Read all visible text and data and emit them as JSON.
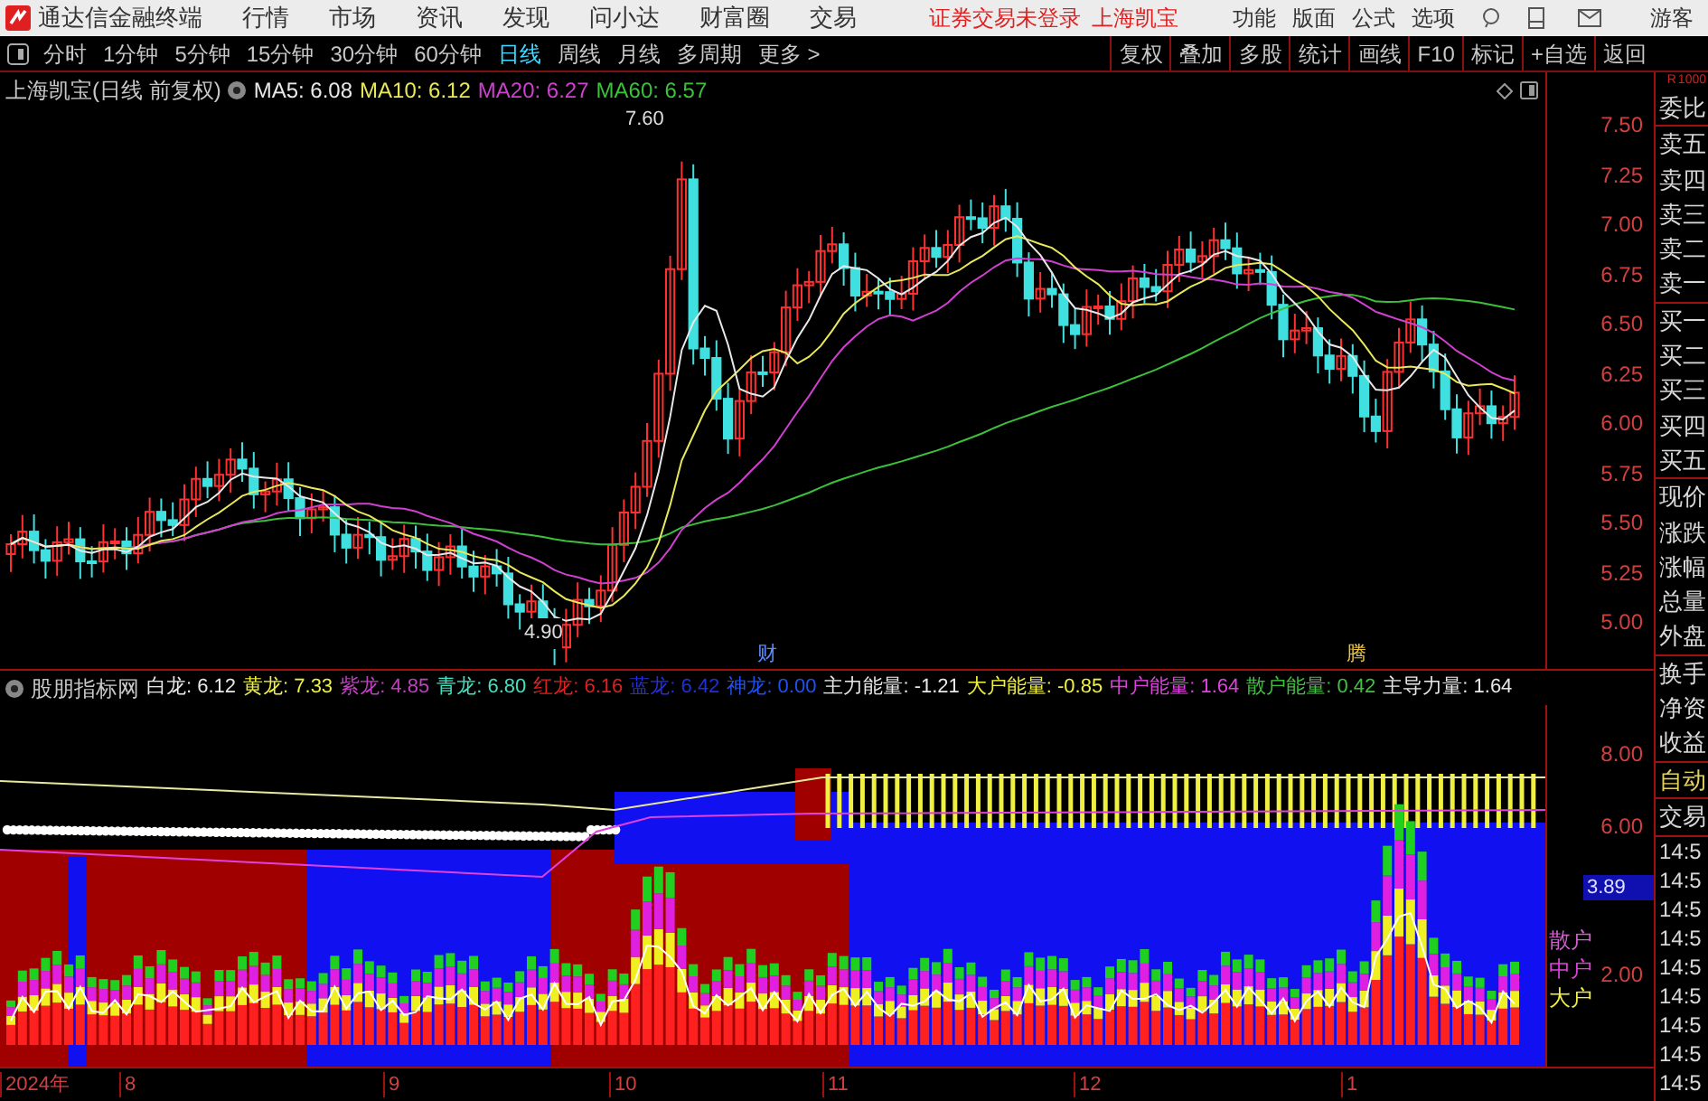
{
  "app": {
    "name": "通达信金融终端"
  },
  "menu": [
    "行情",
    "市场",
    "资讯",
    "发现",
    "问小达",
    "财富圈",
    "交易"
  ],
  "notice": {
    "login": "证券交易未登录",
    "stock": "上海凯宝"
  },
  "title_menu": [
    "功能",
    "版面",
    "公式",
    "选项"
  ],
  "user": "游客",
  "periods": [
    {
      "label": "分时",
      "selected": false
    },
    {
      "label": "1分钟",
      "selected": false
    },
    {
      "label": "5分钟",
      "selected": false
    },
    {
      "label": "15分钟",
      "selected": false
    },
    {
      "label": "30分钟",
      "selected": false
    },
    {
      "label": "60分钟",
      "selected": false
    },
    {
      "label": "日线",
      "selected": true
    },
    {
      "label": "周线",
      "selected": false
    },
    {
      "label": "月线",
      "selected": false
    },
    {
      "label": "多周期",
      "selected": false
    },
    {
      "label": "更多 >",
      "selected": false
    }
  ],
  "tools": [
    "复权",
    "叠加",
    "多股",
    "统计",
    "画线",
    "F10",
    "标记",
    "+自选",
    "返回"
  ],
  "main_chart": {
    "title": "上海凯宝(日线 前复权)",
    "ma": [
      {
        "label": "MA5: 6.08",
        "color": "#e8e8e8"
      },
      {
        "label": "MA10: 6.12",
        "color": "#e8e85a"
      },
      {
        "label": "MA20: 6.27",
        "color": "#d040d0"
      },
      {
        "label": "MA60: 6.57",
        "color": "#3cc03c"
      }
    ],
    "price_axis": [
      "7.50",
      "7.25",
      "7.00",
      "6.75",
      "6.50",
      "6.25",
      "6.00",
      "5.75",
      "5.50",
      "5.25",
      "5.00"
    ],
    "high_label": "7.60",
    "low_label": "4.90",
    "markers": [
      {
        "label": "财",
        "color": "#5a8cff"
      },
      {
        "label": "腾",
        "color": "#e8c040"
      }
    ]
  },
  "indicator": {
    "name": "股朋指标网",
    "values": [
      {
        "label": "白龙: 6.12",
        "color": "#e8e8e8"
      },
      {
        "label": "黄龙: 7.33",
        "color": "#f0f040"
      },
      {
        "label": "紫龙: 4.85",
        "color": "#c040c0"
      },
      {
        "label": "青龙: 6.80",
        "color": "#40e0c0"
      },
      {
        "label": "红龙: 6.16",
        "color": "#e02020"
      },
      {
        "label": "蓝龙: 6.42",
        "color": "#2030e0"
      },
      {
        "label": "神龙: 0.00",
        "color": "#2050f0"
      },
      {
        "label": "主力能量: -1.21",
        "color": "#e8e8e8"
      },
      {
        "label": "大户能量: -0.85",
        "color": "#f0f040"
      },
      {
        "label": "中户能量: 1.64",
        "color": "#e040e0"
      },
      {
        "label": "散户能量: 0.42",
        "color": "#40c040"
      },
      {
        "label": "主导力量: 1.64",
        "color": "#e8e8e8"
      }
    ],
    "axis": [
      "8.00",
      "6.00",
      "2.00"
    ],
    "current": "3.89",
    "legend": [
      {
        "label": "散户",
        "color": "#d060d0"
      },
      {
        "label": "中户",
        "color": "#e040e0"
      },
      {
        "label": "大户",
        "color": "#f0f040"
      }
    ]
  },
  "date_axis": [
    "2024年",
    "8",
    "9",
    "10",
    "11",
    "12",
    "1"
  ],
  "quote_panel": {
    "badge": "R",
    "badge_value": "1000",
    "groups": [
      [
        "委比"
      ],
      [
        "卖五",
        "卖四",
        "卖三",
        "卖二",
        "卖一"
      ],
      [
        "买一",
        "买二",
        "买三",
        "买四",
        "买五"
      ],
      [
        "现价",
        "涨跌",
        "涨幅",
        "总量",
        "外盘"
      ],
      [
        "换手",
        "净资",
        "收益"
      ]
    ],
    "auto": "自动",
    "trade": "交易",
    "times": [
      "14:5",
      "14:5",
      "14:5",
      "14:5",
      "14:5",
      "14:5",
      "14:5",
      "14:5",
      "14:5"
    ]
  }
}
